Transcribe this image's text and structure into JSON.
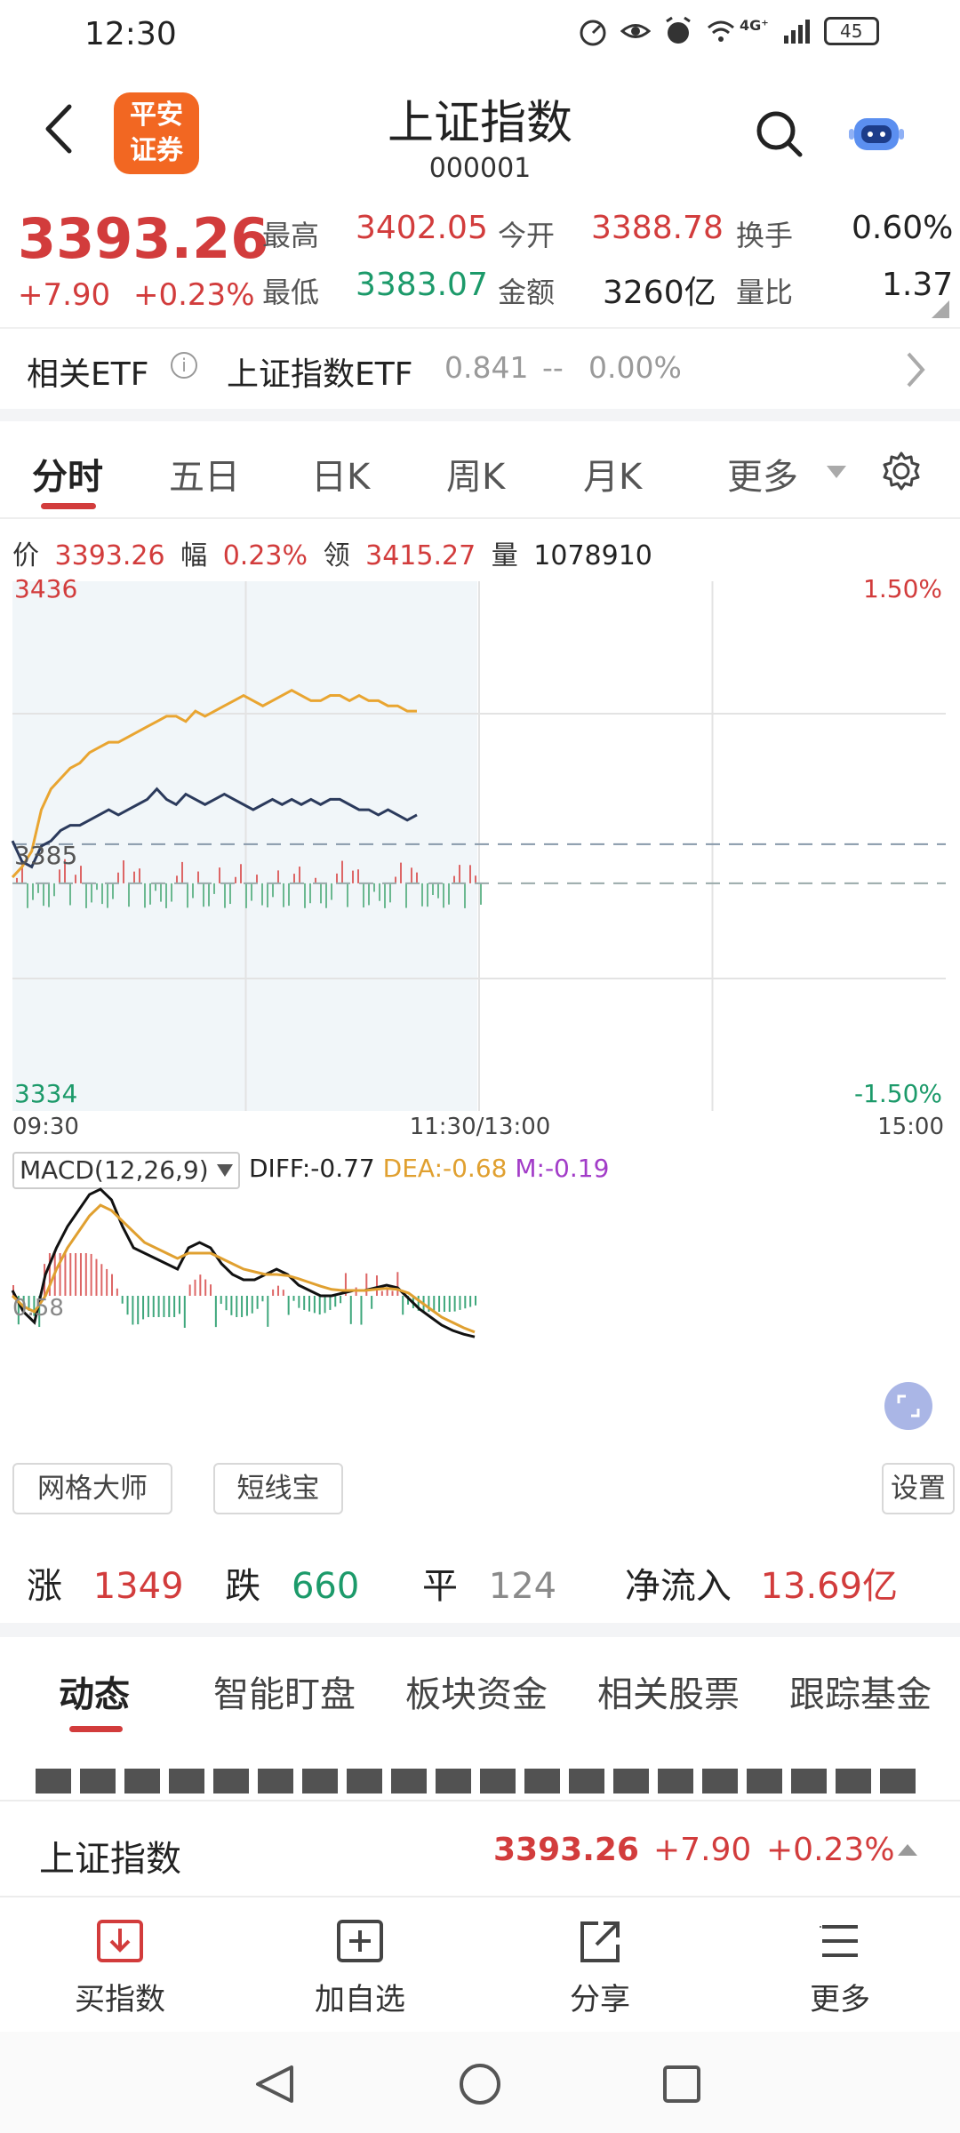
{
  "status_bar": {
    "time": "12:30",
    "network": "4G⁺",
    "battery": "45",
    "icons": [
      "speedometer-icon",
      "eye-icon",
      "alarm-icon",
      "wifi-icon",
      "signal-icon",
      "battery-icon"
    ]
  },
  "header": {
    "logo_line1": "平安",
    "logo_line2": "证券",
    "title": "上证指数",
    "code": "000001"
  },
  "quote": {
    "price": "3393.26",
    "change": "+7.90",
    "change_pct": "+0.23%",
    "high_label": "最高",
    "high": "3402.05",
    "low_label": "最低",
    "low": "3383.07",
    "open_label": "今开",
    "open": "3388.78",
    "amount_label": "金额",
    "amount": "3260亿",
    "turnover_label": "换手",
    "turnover": "0.60%",
    "vol_ratio_label": "量比",
    "vol_ratio": "1.37"
  },
  "etf": {
    "label": "相关ETF",
    "name": "上证指数ETF",
    "price": "0.841",
    "change": "--",
    "change_pct": "0.00%"
  },
  "chart_tabs": [
    "分时",
    "五日",
    "日K",
    "周K",
    "月K",
    "更多"
  ],
  "info_row": {
    "price_label": "价",
    "price": "3393.26",
    "amp_label": "幅",
    "amp": "0.23%",
    "lead_label": "领",
    "lead": "3415.27",
    "vol_label": "量",
    "vol": "1078910"
  },
  "chart_data": {
    "type": "line",
    "y_left_top": "3436",
    "y_left_bottom": "3334",
    "y_mid_label": "3385",
    "y_right_top": "1.50%",
    "y_right_bottom": "-1.50%",
    "x_labels": [
      "09:30",
      "11:30/13:00",
      "15:00"
    ],
    "prev_close": 3385.36,
    "ylim": [
      3334,
      3436
    ],
    "series": [
      {
        "color": "#e9a531",
        "values": [
          3379,
          3381,
          3384,
          3392,
          3396,
          3398,
          3400,
          3401,
          3403,
          3404,
          3405,
          3405,
          3406,
          3407,
          3408,
          3409,
          3410,
          3410,
          3409,
          3411,
          3410,
          3411,
          3412,
          3413,
          3414,
          3413,
          3412,
          3413,
          3414,
          3415,
          3414,
          3413,
          3413,
          3414,
          3414,
          3413,
          3414,
          3413,
          3413,
          3412,
          3412,
          3411,
          3411
        ]
      },
      {
        "color": "#2b3a5c",
        "values": [
          3386,
          3382,
          3381,
          3385,
          3386,
          3388,
          3389,
          3389,
          3390,
          3391,
          3392,
          3391,
          3392,
          3393,
          3394,
          3396,
          3394,
          3393,
          3395,
          3394,
          3393,
          3394,
          3395,
          3394,
          3393,
          3392,
          3393,
          3394,
          3393,
          3394,
          3393,
          3394,
          3393,
          3394,
          3394,
          3393,
          3392,
          3392,
          3391,
          3392,
          3391,
          3390,
          3391
        ]
      }
    ],
    "macd": {
      "label": "MACD(12,26,9)",
      "diff_label": "DIFF:-0.77",
      "dea_label": "DEA:-0.68",
      "m_label": "M:-0.19",
      "axis_label": "0.58",
      "diff": [
        0.1,
        -0.3,
        -0.5,
        0.4,
        0.9,
        1.3,
        1.6,
        1.9,
        2.0,
        1.8,
        1.3,
        0.9,
        0.8,
        0.7,
        0.6,
        0.5,
        0.9,
        1.0,
        0.9,
        0.6,
        0.4,
        0.3,
        0.3,
        0.4,
        0.5,
        0.4,
        0.2,
        0.1,
        0.0,
        0.0,
        0.05,
        0.1,
        0.1,
        0.15,
        0.2,
        0.15,
        -0.05,
        -0.25,
        -0.4,
        -0.55,
        -0.65,
        -0.72,
        -0.77
      ],
      "dea": [
        0.0,
        -0.2,
        -0.3,
        0.0,
        0.5,
        0.9,
        1.2,
        1.5,
        1.7,
        1.6,
        1.4,
        1.2,
        1.0,
        0.9,
        0.8,
        0.7,
        0.8,
        0.8,
        0.8,
        0.7,
        0.6,
        0.5,
        0.45,
        0.4,
        0.4,
        0.38,
        0.32,
        0.25,
        0.18,
        0.12,
        0.1,
        0.1,
        0.1,
        0.12,
        0.14,
        0.12,
        0.05,
        -0.1,
        -0.25,
        -0.4,
        -0.5,
        -0.6,
        -0.68
      ]
    }
  },
  "tools": {
    "grid": "网格大师",
    "short": "短线宝",
    "settings": "设置"
  },
  "breadth": {
    "up_label": "涨",
    "up": "1349",
    "down_label": "跌",
    "down": "660",
    "flat_label": "平",
    "flat": "124",
    "inflow_label": "净流入",
    "inflow": "13.69亿"
  },
  "news_tabs": [
    "动态",
    "智能盯盘",
    "板块资金",
    "相关股票",
    "跟踪基金"
  ],
  "bottom_quote": {
    "name": "上证指数",
    "price": "3393.26",
    "change": "+7.90",
    "change_pct": "+0.23%"
  },
  "actions": [
    "买指数",
    "加自选",
    "分享",
    "更多"
  ]
}
